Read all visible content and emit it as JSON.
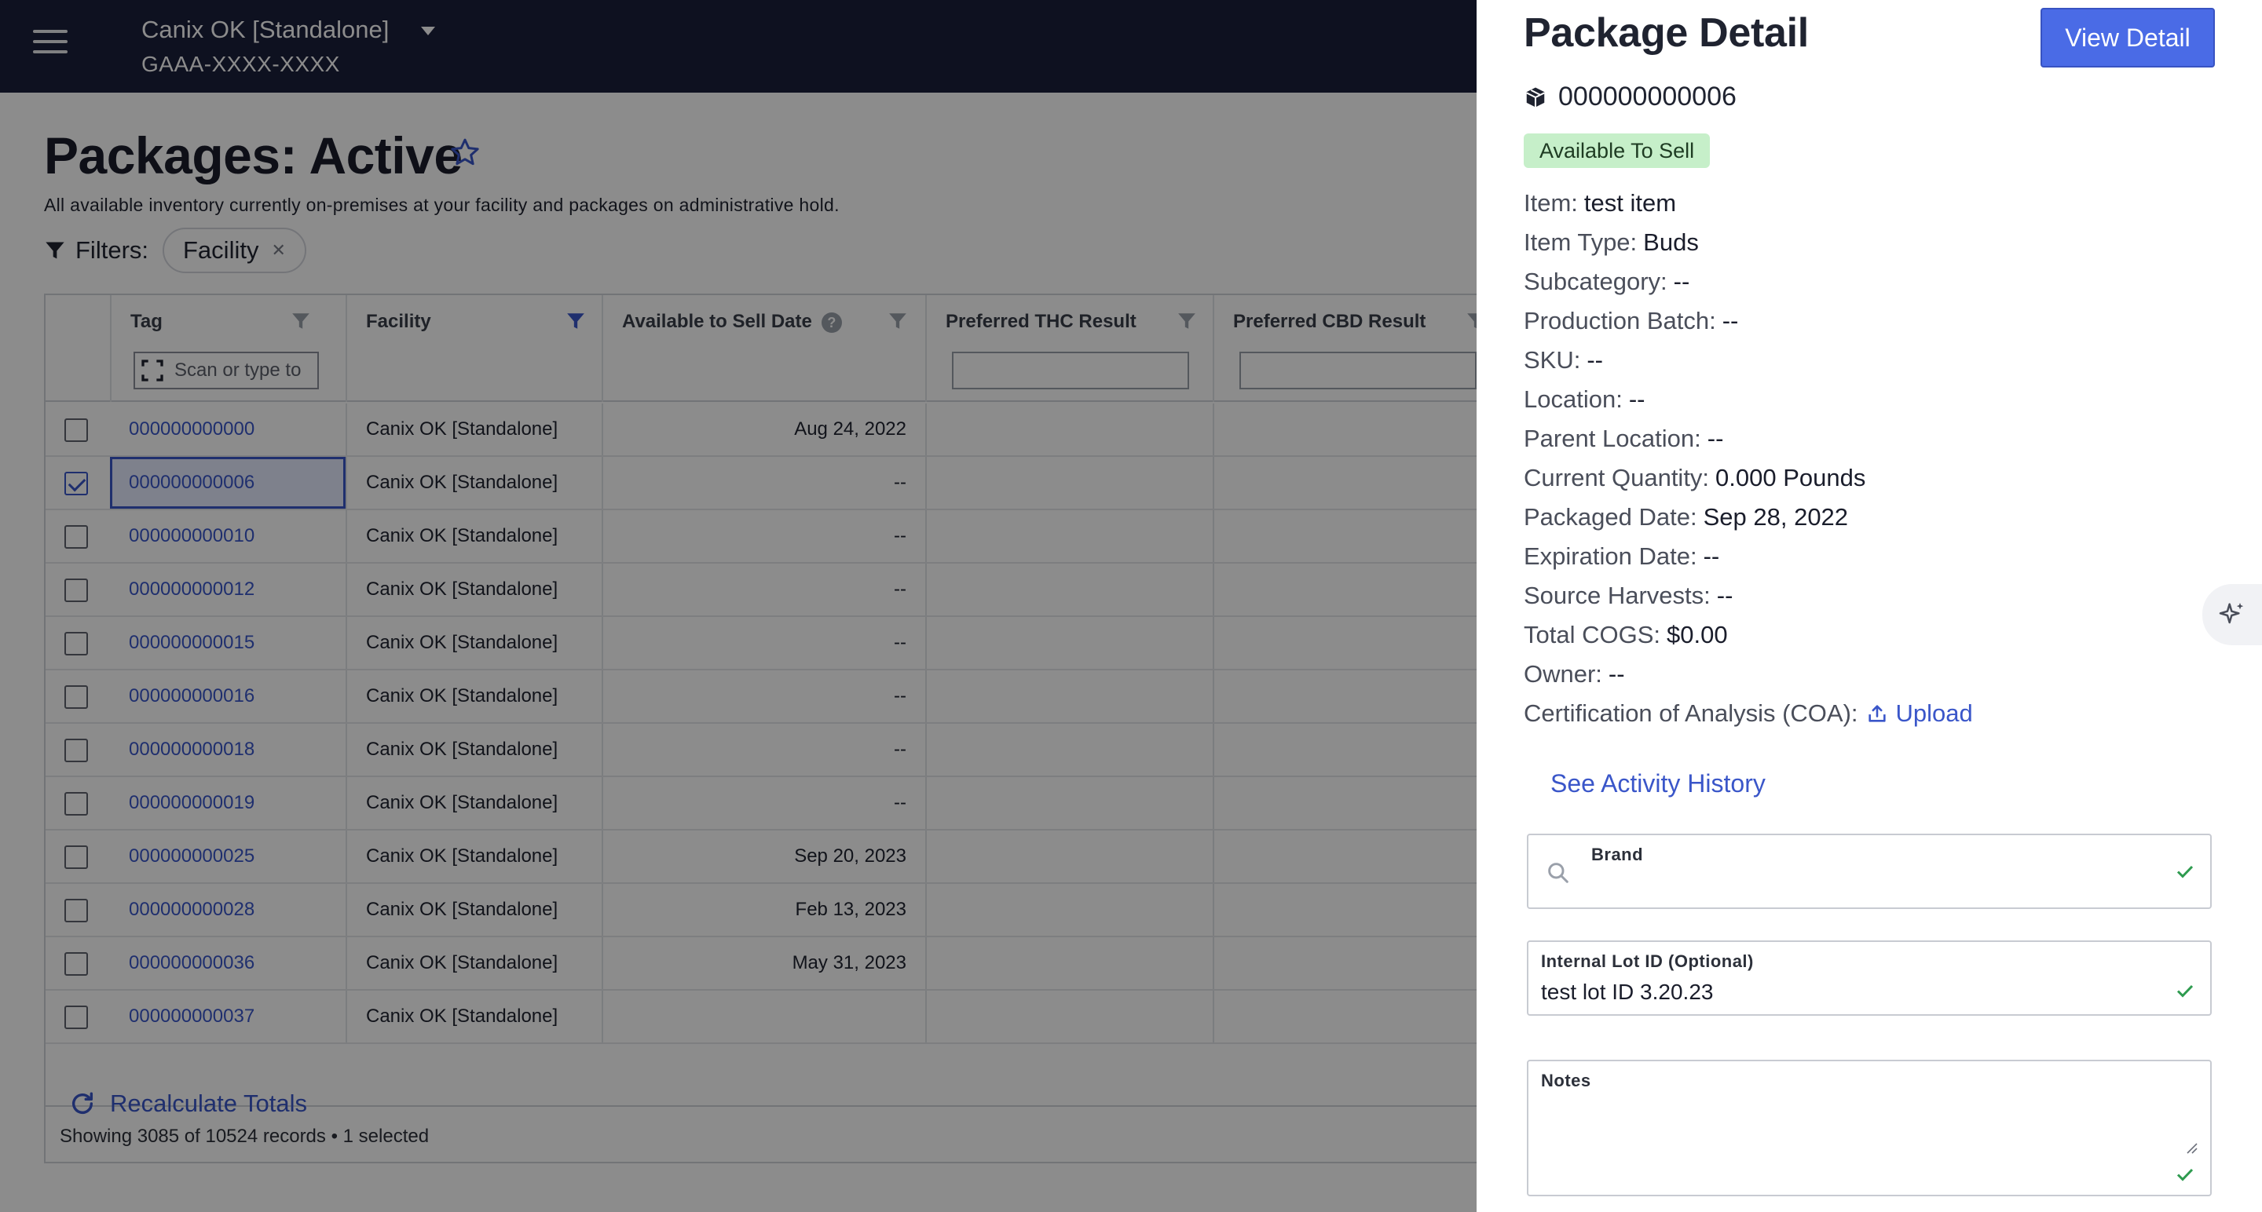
{
  "header": {
    "facility_name": "Canix OK [Standalone]",
    "license": "GAAA-XXXX-XXXX"
  },
  "page": {
    "title": "Packages: Active",
    "subtitle": "All available inventory currently on-premises at your facility and packages on administrative hold.",
    "filters_label": "Filters:",
    "filter_chips": [
      "Facility"
    ]
  },
  "grid": {
    "columns": {
      "tag": "Tag",
      "facility": "Facility",
      "available_date": "Available to Sell Date",
      "thc": "Preferred THC Result",
      "cbd": "Preferred CBD Result"
    },
    "scan_placeholder": "Scan or type to",
    "rows": [
      {
        "tag": "000000000000",
        "facility": "Canix OK [Standalone]",
        "date": "Aug 24, 2022",
        "checked": false
      },
      {
        "tag": "000000000006",
        "facility": "Canix OK [Standalone]",
        "date": "--",
        "checked": true
      },
      {
        "tag": "000000000010",
        "facility": "Canix OK [Standalone]",
        "date": "--",
        "checked": false
      },
      {
        "tag": "000000000012",
        "facility": "Canix OK [Standalone]",
        "date": "--",
        "checked": false
      },
      {
        "tag": "000000000015",
        "facility": "Canix OK [Standalone]",
        "date": "--",
        "checked": false
      },
      {
        "tag": "000000000016",
        "facility": "Canix OK [Standalone]",
        "date": "--",
        "checked": false
      },
      {
        "tag": "000000000018",
        "facility": "Canix OK [Standalone]",
        "date": "--",
        "checked": false
      },
      {
        "tag": "000000000019",
        "facility": "Canix OK [Standalone]",
        "date": "--",
        "checked": false
      },
      {
        "tag": "000000000025",
        "facility": "Canix OK [Standalone]",
        "date": "Sep 20, 2023",
        "checked": false
      },
      {
        "tag": "000000000028",
        "facility": "Canix OK [Standalone]",
        "date": "Feb 13, 2023",
        "checked": false
      },
      {
        "tag": "000000000036",
        "facility": "Canix OK [Standalone]",
        "date": "May 31, 2023",
        "checked": false
      },
      {
        "tag": "000000000037",
        "facility": "Canix OK [Standalone]",
        "date": "",
        "checked": false
      }
    ],
    "footer": "Showing 3085 of 10524 records • 1 selected"
  },
  "recalculate_label": "Recalculate Totals",
  "panel": {
    "title": "Package Detail",
    "view_detail_label": "View Detail",
    "package_id": "000000000006",
    "status": "Available To Sell",
    "details": [
      {
        "label": "Item:",
        "value": "test item"
      },
      {
        "label": "Item Type:",
        "value": "Buds"
      },
      {
        "label": "Subcategory:",
        "value": "--"
      },
      {
        "label": "Production Batch:",
        "value": "--"
      },
      {
        "label": "SKU:",
        "value": "--"
      },
      {
        "label": "Location:",
        "value": "--"
      },
      {
        "label": "Parent Location:",
        "value": "--"
      },
      {
        "label": "Current Quantity:",
        "value": "0.000 Pounds"
      },
      {
        "label": "Packaged Date:",
        "value": "Sep 28, 2022"
      },
      {
        "label": "Expiration Date:",
        "value": "--"
      },
      {
        "label": "Source Harvests:",
        "value": "--"
      },
      {
        "label": "Total COGS:",
        "value": "$0.00"
      },
      {
        "label": "Owner:",
        "value": "--"
      }
    ],
    "coa_label": "Certification of Analysis (COA):",
    "upload_label": "Upload",
    "activity_history_label": "See Activity History",
    "brand_label": "Brand",
    "lot_label": "Internal Lot ID (Optional)",
    "lot_value": "test lot ID 3.20.23",
    "notes_label": "Notes",
    "notes_value": ""
  },
  "colors": {
    "topbar": "#1b1f3b",
    "accent": "#3a56c9",
    "button": "#4a6be6",
    "badge_bg": "#c6efc9",
    "check": "#2e9b4f"
  }
}
